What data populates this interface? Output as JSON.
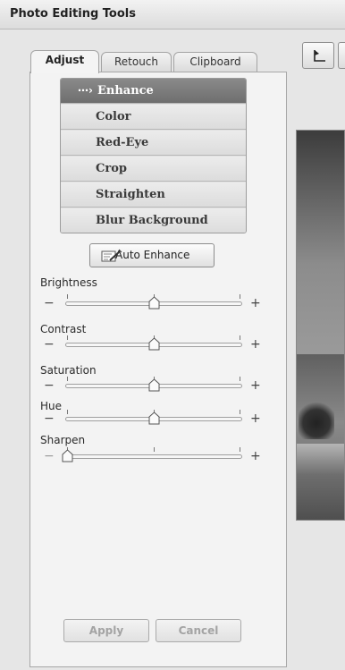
{
  "window": {
    "title": "Photo Editing Tools"
  },
  "tabs": [
    {
      "label": "Adjust",
      "active": true
    },
    {
      "label": "Retouch",
      "active": false
    },
    {
      "label": "Clipboard",
      "active": false
    }
  ],
  "menu": {
    "items": [
      {
        "label": "Enhance",
        "selected": true
      },
      {
        "label": "Color",
        "selected": false
      },
      {
        "label": "Red-Eye",
        "selected": false
      },
      {
        "label": "Crop",
        "selected": false
      },
      {
        "label": "Straighten",
        "selected": false
      },
      {
        "label": "Blur Background",
        "selected": false
      }
    ]
  },
  "auto_enhance": {
    "label": "Auto Enhance",
    "icon": "magic-wand-icon"
  },
  "sliders": [
    {
      "label": "Brightness",
      "value": 0.5,
      "minus": "−",
      "plus": "+"
    },
    {
      "label": "Contrast",
      "value": 0.5,
      "minus": "−",
      "plus": "+"
    },
    {
      "label": "Saturation",
      "value": 0.5,
      "minus": "−",
      "plus": "+"
    },
    {
      "label": "Hue",
      "value": 0.5,
      "minus": "−",
      "plus": "+"
    },
    {
      "label": "Sharpen",
      "value": 0.0,
      "minus": "−",
      "plus": "+"
    }
  ],
  "footer": {
    "apply_label": "Apply",
    "cancel_label": "Cancel"
  },
  "toolbar": {
    "undo_icon": "undo-icon"
  },
  "colors": {
    "selected_item_bg": "#7c7c7c",
    "panel_bg": "#f3f3f3",
    "disabled_text": "#a3a3a3"
  }
}
